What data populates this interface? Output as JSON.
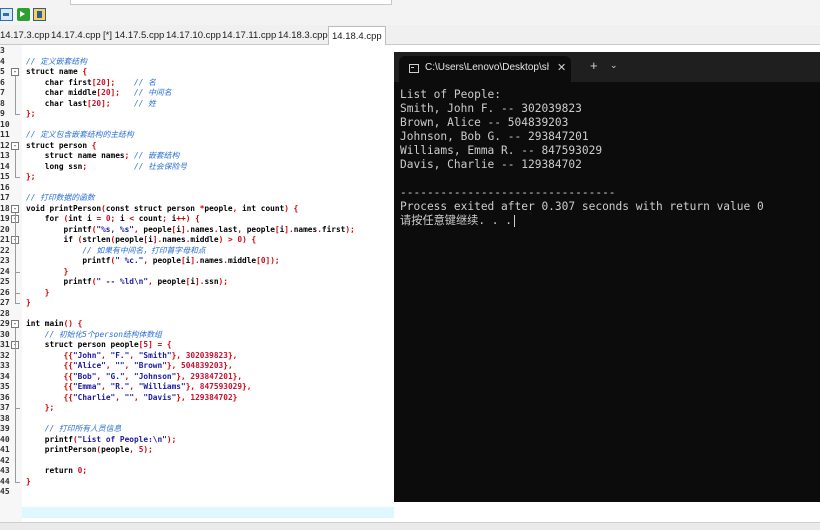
{
  "tabs": [
    "14.17.3.cpp",
    "14.17.4.cpp",
    "[*] 14.17.5.cpp",
    "14.17.10.cpp",
    "14.17.11.cpp",
    "14.18.3.cpp",
    "14.18.4.cpp"
  ],
  "active_tab_index": 6,
  "editor": {
    "line_numbers": [
      "3",
      "4",
      "5",
      "6",
      "7",
      "8",
      "9",
      "10",
      "11",
      "12",
      "13",
      "14",
      "15",
      "16",
      "17",
      "18",
      "19",
      "20",
      "21",
      "22",
      "23",
      "24",
      "25",
      "26",
      "27",
      "28",
      "29",
      "30",
      "31",
      "32",
      "33",
      "34",
      "35",
      "36",
      "37",
      "38",
      "39",
      "40",
      "41",
      "42",
      "43",
      "44",
      "45"
    ],
    "fold_markers": {
      "5": "-",
      "12": "-",
      "18": "-",
      "19": "-",
      "21": "-",
      "29": "-",
      "31": "-"
    },
    "lines": [
      "",
      "// 定义嵌套结构",
      "struct name {",
      "    char first[20];    // 名",
      "    char middle[20];   // 中间名",
      "    char last[20];     // 姓",
      "};",
      "",
      "// 定义包含嵌套结构的主结构",
      "struct person {",
      "    struct name names; // 嵌套结构",
      "    long ssn;          // 社会保险号",
      "};",
      "",
      "// 打印数据的函数",
      "void printPerson(const struct person *people, int count) {",
      "    for (int i = 0; i < count; i++) {",
      "        printf(\"%s, %s\", people[i].names.last, people[i].names.first);",
      "        if (strlen(people[i].names.middle) > 0) {",
      "            // 如果有中间名，打印首字母和点",
      "            printf(\" %c.\", people[i].names.middle[0]);",
      "        }",
      "        printf(\" -- %ld\\n\", people[i].ssn);",
      "    }",
      "}",
      "",
      "int main() {",
      "    // 初始化5个person结构体数组",
      "    struct person people[5] = {",
      "        {{\"John\", \"F.\", \"Smith\"}, 302039823},",
      "        {{\"Alice\", \"\", \"Brown\"}, 504839203},",
      "        {{\"Bob\", \"G.\", \"Johnson\"}, 293847201},",
      "        {{\"Emma\", \"R.\", \"Williams\"}, 847593029},",
      "        {{\"Charlie\", \"\", \"Davis\"}, 129384702}",
      "    };",
      "",
      "    // 打印所有人员信息",
      "    printf(\"List of People:\\n\");",
      "    printPerson(people, 5);",
      "",
      "    return 0;",
      "}",
      ""
    ]
  },
  "console": {
    "tab_title": "C:\\Users\\Lenovo\\Desktop\\sha",
    "close_glyph": "✕",
    "add_glyph": "+",
    "dropdown_glyph": "⌄",
    "icon": "terminal-icon",
    "output": [
      "List of People:",
      "Smith, John F. -- 302039823",
      "Brown, Alice -- 504839203",
      "Johnson, Bob G. -- 293847201",
      "Williams, Emma R. -- 847593029",
      "Davis, Charlie -- 129384702",
      "",
      "--------------------------------",
      "Process exited after 0.307 seconds with return value 0",
      "请按任意键继续. . ."
    ]
  },
  "colors": {
    "comment": "#2a6fd6",
    "string": "#1a1aa6",
    "number": "#c8102e",
    "console_bg": "#0c0c0c",
    "console_text": "#cccccc",
    "current_line": "#dff7ff"
  },
  "toolbar_icons": [
    "module-icon",
    "run-icon",
    "save-icon"
  ]
}
